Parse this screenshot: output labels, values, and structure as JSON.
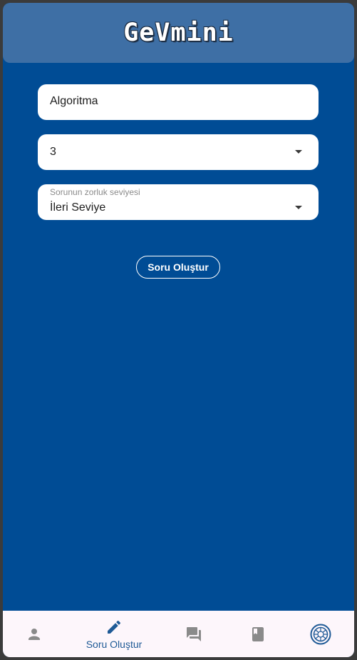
{
  "app": {
    "title": "GeVmini"
  },
  "form": {
    "topic_value": "Algoritma",
    "count_value": "3",
    "difficulty_caption": "Sorunun zorluk seviyesi",
    "difficulty_value": "İleri Seviye",
    "create_button_label": "Soru Oluştur"
  },
  "bottom_nav": {
    "items": [
      {
        "icon": "person-icon",
        "label": "",
        "active": false
      },
      {
        "icon": "edit-pencil-icon",
        "label": "Soru Oluştur",
        "active": true
      },
      {
        "icon": "forum-icon",
        "label": "",
        "active": false
      },
      {
        "icon": "book-icon",
        "label": "",
        "active": false
      },
      {
        "icon": "app-logo-icon",
        "label": "",
        "active": false
      }
    ]
  },
  "colors": {
    "background": "#004c95",
    "app_bar": "#3e6fa5",
    "nav_background": "#fdf6fb",
    "nav_active": "#1f5a96",
    "nav_inactive": "#8a8a8a"
  }
}
